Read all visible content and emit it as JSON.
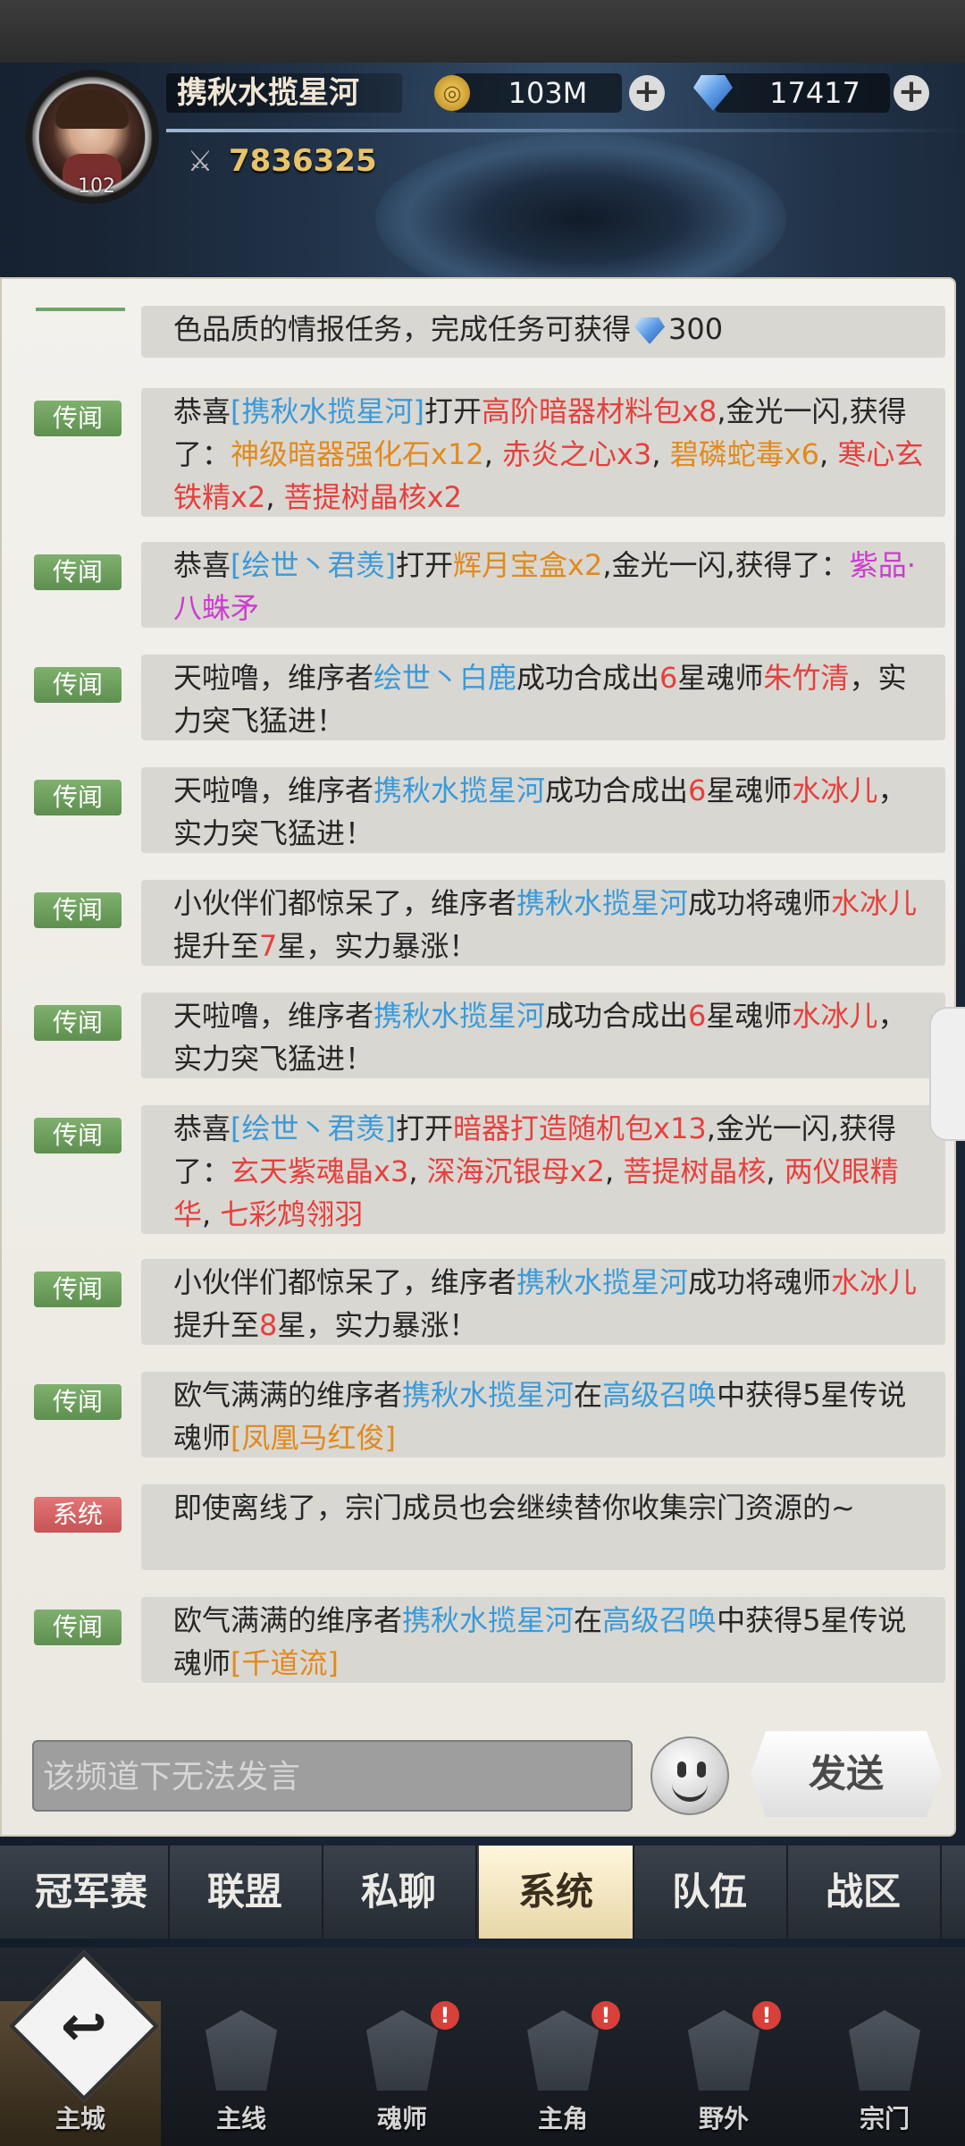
{
  "player": {
    "name": "携秋水揽星河",
    "level": "102",
    "power": "7836325"
  },
  "currency": {
    "gold": "103M",
    "diamonds": "17417"
  },
  "chat": {
    "first_line": "色品质的情报任务，完成任务可获得",
    "first_line_amount": "300",
    "tag_legend": "传闻",
    "tag_system": "系统",
    "messages": [
      {
        "segments": [
          "恭喜",
          "[携秋水揽星河]",
          "打开",
          "高阶暗器材料包x8",
          ",金光一闪,获得了：",
          "神级暗器强化石x12",
          ", ",
          "赤炎之心x3",
          ", ",
          "碧磷蛇毒x6",
          ", ",
          "寒心玄铁精x2",
          ", ",
          "菩提树晶核x2"
        ]
      },
      {
        "segments": [
          "恭喜",
          "[绘世丶君羡]",
          "打开",
          "辉月宝盒x2",
          ",金光一闪,获得了：",
          "紫品·八蛛矛"
        ]
      },
      {
        "segments": [
          "天啦噜，维序者",
          "绘世丶白鹿",
          "成功合成出",
          "6",
          "星魂师",
          "朱竹清",
          "，实力突飞猛进！"
        ]
      },
      {
        "segments": [
          "天啦噜，维序者",
          "携秋水揽星河",
          "成功合成出",
          "6",
          "星魂师",
          "水冰儿",
          "，实力突飞猛进！"
        ]
      },
      {
        "segments": [
          "小伙伴们都惊呆了，维序者",
          "携秋水揽星河",
          "成功将魂师",
          "水冰儿",
          "提升至",
          "7",
          "星，实力暴涨！"
        ]
      },
      {
        "segments": [
          "天啦噜，维序者",
          "携秋水揽星河",
          "成功合成出",
          "6",
          "星魂师",
          "水冰儿",
          "，实力突飞猛进！"
        ]
      },
      {
        "segments": [
          "恭喜",
          "[绘世丶君羡]",
          "打开",
          "暗器打造随机包x13",
          ",金光一闪,获得了：",
          "玄天紫魂晶x3",
          ", ",
          "深海沉银母x2",
          ", ",
          "菩提树晶核",
          ", ",
          "两仪眼精华",
          ", ",
          "七彩鸩翎羽"
        ]
      },
      {
        "segments": [
          "小伙伴们都惊呆了，维序者",
          "携秋水揽星河",
          "成功将魂师",
          "水冰儿",
          "提升至",
          "8",
          "星，实力暴涨！"
        ]
      },
      {
        "segments": [
          "欧气满满的维序者",
          "携秋水揽星河",
          "在",
          "高级召唤",
          "中获得5星传说魂师",
          "[凤凰马红俊]"
        ]
      },
      {
        "segments": [
          "即使离线了，宗门成员也会继续替你收集宗门资源的~"
        ]
      },
      {
        "segments": [
          "欧气满满的维序者",
          "携秋水揽星河",
          "在",
          "高级召唤",
          "中获得5星传说魂师",
          "[千道流]"
        ]
      }
    ],
    "input_placeholder": "该频道下无法发言",
    "send_label": "发送"
  },
  "tabs": [
    "冠军赛",
    "联盟",
    "私聊",
    "系统",
    "队伍",
    "战区"
  ],
  "active_tab": "系统",
  "nav": [
    "主城",
    "主线",
    "魂师",
    "主角",
    "野外",
    "宗门"
  ],
  "nav_badge": "!"
}
